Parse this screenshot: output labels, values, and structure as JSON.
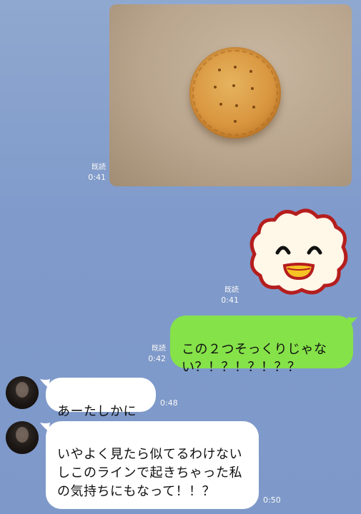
{
  "messages": {
    "photo": {
      "read_label": "既読",
      "time": "0:41",
      "subject": "round cracker"
    },
    "sticker": {
      "read_label": "既読",
      "time": "0:41",
      "subject": "smiling cloud sticker"
    },
    "outgoing_text": {
      "text": "この２つそっくりじゃない？！？！？！？？",
      "read_label": "既読",
      "time": "0:42"
    },
    "incoming_1": {
      "text": "あーたしかに",
      "time": "0:48"
    },
    "incoming_2": {
      "text": "いやよく見たら似てるわけないしこのラインで起きちゃった私の気持ちにもなって！！？",
      "time": "0:50"
    }
  },
  "colors": {
    "background": "#8fa8cf",
    "outgoing_bubble": "#85e249",
    "incoming_bubble": "#ffffff",
    "meta_text": "#ffffff"
  }
}
